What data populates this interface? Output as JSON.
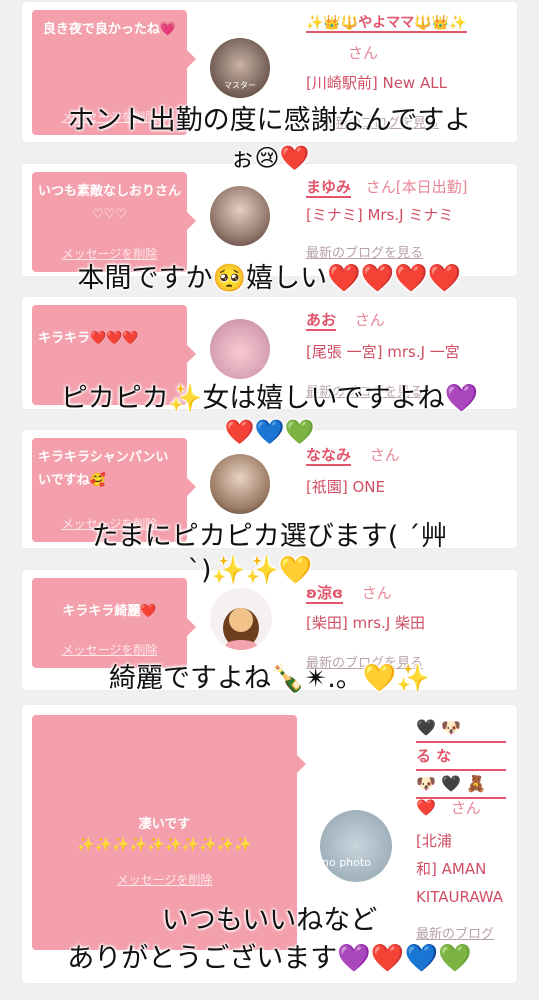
{
  "delete_label": "メッセージを削除",
  "blog_label": "最新のブログを見る",
  "blog_label_short": "最新のブログ",
  "san": "さん",
  "cards": [
    {
      "message": "良き夜で良かったね💗",
      "name": "✨👑🔱やよママ🔱👑✨",
      "shop": "[川崎駅前] New ALL"
    },
    {
      "message": "いつも素敵なしおりさん♡♡♡",
      "name": "まゆみ",
      "name_suffix": "さん[本日出勤]",
      "shop": "[ミナミ] Mrs.J ミナミ"
    },
    {
      "message": "キラキラ❤️❤️❤️",
      "name": "あお",
      "shop": "[尾張 一宮] mrs.J 一宮"
    },
    {
      "message": "キラキラシャンパンいいですね🥰",
      "name": "ななみ",
      "shop": "[祇園] ONE"
    },
    {
      "message": "キラキラ綺麗❤️",
      "name": "ʚ涼ɞ",
      "shop": "[柴田] mrs.J 柴田"
    },
    {
      "message": "凄いです",
      "sparkles": "✨✨✨✨✨✨✨✨✨✨",
      "name_line1": "🖤 🐶",
      "name_line2": "る な",
      "name_line3": "🐶 🖤 🧸",
      "name_line4": "❤️",
      "shop_line1": "[北浦",
      "shop_line2": "和] AMAN",
      "shop_line3": "KITAURAWA",
      "avatar_text": "no photo"
    }
  ],
  "overlays": [
    "ホント出勤の度に感謝なんですよ",
    "ぉ😢❤️",
    "本間ですか🥺嬉しい❤️❤️❤️❤️",
    "ピカピカ✨女は嬉しいですよね💜",
    "❤️💙💚",
    "たまにピカピカ選びます( ´艸",
    "`)✨✨💛",
    "綺麗ですよね🍾✴︎.。💛✨",
    "いつもいいねなど",
    "ありがとうございます💜❤️💙💚"
  ],
  "avatar_watermark": "マスター"
}
